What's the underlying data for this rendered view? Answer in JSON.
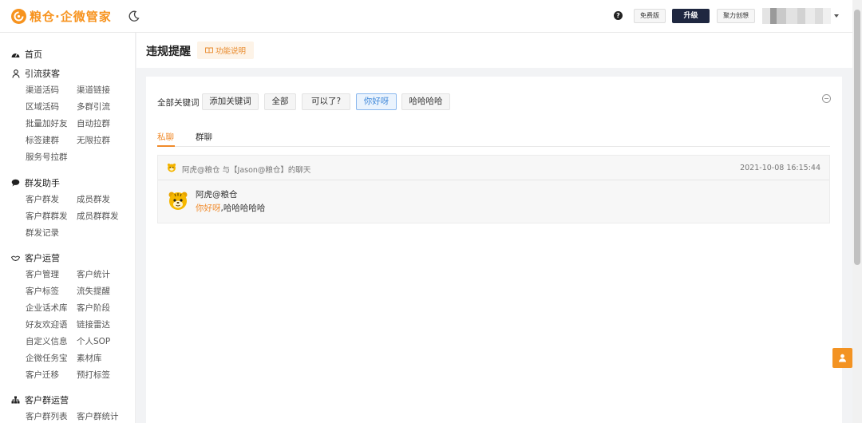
{
  "header": {
    "logo_text": "粮仓·企微管家",
    "help_glyph": "?",
    "free_label": "免费版",
    "upgrade_label": "升级",
    "team_label": "聚力创想"
  },
  "sidebar": {
    "home": "首页",
    "sections": [
      {
        "title": "引流获客",
        "icon": "person-icon",
        "items": [
          "渠道活码",
          "渠道链接",
          "区域活码",
          "多群引流",
          "批量加好友",
          "自动拉群",
          "标签建群",
          "无限拉群",
          "服务号拉群"
        ]
      },
      {
        "title": "群发助手",
        "icon": "chat-bubble-icon",
        "items": [
          "客户群发",
          "成员群发",
          "客户群群发",
          "成员群群发",
          "群发记录"
        ]
      },
      {
        "title": "客户运营",
        "icon": "handshake-icon",
        "items": [
          "客户管理",
          "客户统计",
          "客户标签",
          "流失提醒",
          "企业话术库",
          "客户阶段",
          "好友欢迎语",
          "链接雷达",
          "自定义信息",
          "个人SOP",
          "企微任务宝",
          "素材库",
          "客户迁移",
          "预打标签"
        ]
      },
      {
        "title": "客户群运营",
        "icon": "org-chart-icon",
        "items": [
          "客户群列表",
          "客户群统计"
        ]
      }
    ]
  },
  "page": {
    "title": "违规提醒",
    "func_label": "功能说明"
  },
  "keywords": {
    "label": "全部关键词",
    "add_label": "添加关键词",
    "chips": [
      "全部",
      "可以了?",
      "你好呀",
      "哈哈哈哈"
    ],
    "active_chip": "你好呀"
  },
  "tabs": [
    "私聊",
    "群聊"
  ],
  "active_tab": "私聊",
  "chat": {
    "title": "阿虎@粮仓 与【Jason@粮仓】的聊天",
    "time": "2021-10-08 16:15:44",
    "sender": "阿虎@粮仓",
    "message_highlight": "你好呀",
    "message_rest": ",哈哈哈哈哈"
  },
  "colors": {
    "brand_orange": "#f7931e",
    "upgrade_bg": "#1f2740",
    "active_chip_text": "#3d86d8"
  }
}
